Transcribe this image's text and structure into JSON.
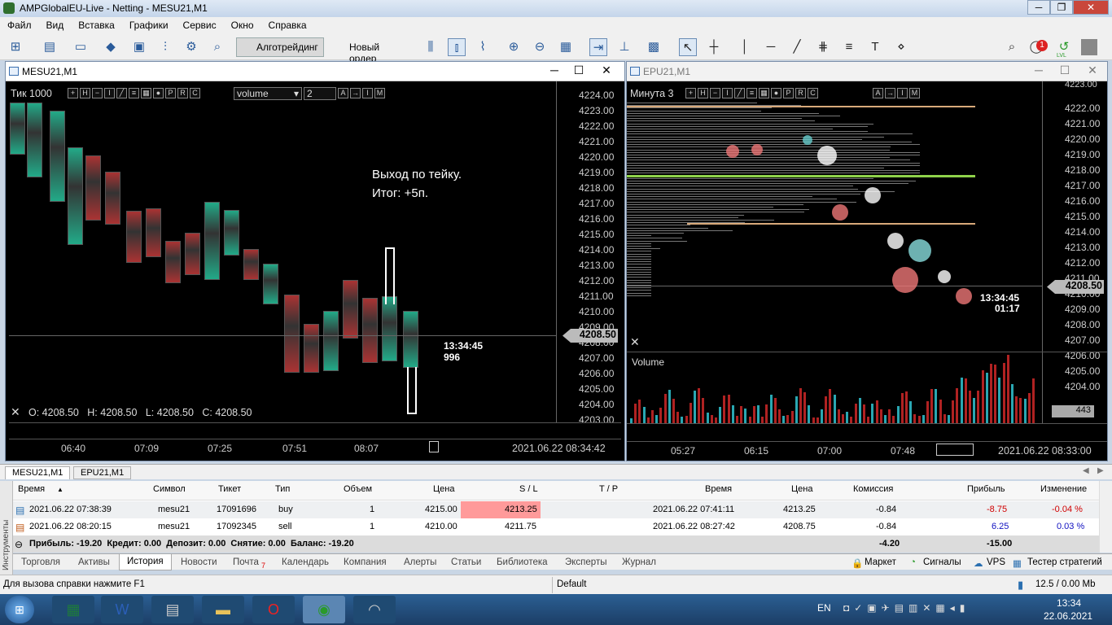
{
  "window": {
    "title": "AMPGlobalEU-Live - Netting - MESU21,M1"
  },
  "menu": [
    "Файл",
    "Вид",
    "Вставка",
    "Графики",
    "Сервис",
    "Окно",
    "Справка"
  ],
  "toolbar": {
    "algo": "Алготрейдинг",
    "new_order": "Новый ордер",
    "notif_count": "1",
    "lvl": "LVL"
  },
  "chart1": {
    "title": "MESU21,M1",
    "mode": "Тик  1000",
    "select": "volume",
    "num": "2",
    "prices": [
      "4224.00",
      "4223.00",
      "4222.00",
      "4221.00",
      "4220.00",
      "4219.00",
      "4218.00",
      "4217.00",
      "4216.00",
      "4215.00",
      "4214.00",
      "4213.00",
      "4212.00",
      "4211.00",
      "4210.00",
      "4209.00",
      "4208.00",
      "4207.00",
      "4206.00",
      "4205.00",
      "4204.00",
      "4203.00"
    ],
    "current": "4208.50",
    "timer": "13:34:45",
    "timer2": "996",
    "annotation1": "Выход по тейку.",
    "annotation2": "Итог: +5п.",
    "ohlc": "O: 4208.50   H: 4208.50   L: 4208.50   C: 4208.50",
    "times": [
      "06:40",
      "07:09",
      "07:25",
      "07:51",
      "08:07"
    ],
    "date": "2021.06.22 08:34:42"
  },
  "chart2": {
    "title": "EPU21,M1",
    "mode": "Минута  3",
    "prices": [
      "4222.00",
      "4221.00",
      "4220.00",
      "4219.00",
      "4218.00",
      "4217.00",
      "4216.00",
      "4215.00",
      "4214.00",
      "4213.00",
      "4212.00",
      "4211.00",
      "4210.00",
      "4209.00",
      "4208.00",
      "4207.00",
      "4206.00",
      "4205.00",
      "4204.00"
    ],
    "top_price": "4223.00",
    "current": "4208.50",
    "timer": "13:34:45",
    "timer2": "01:17",
    "volume_label": "Volume",
    "volume_value": "443",
    "times": [
      "05:27",
      "06:15",
      "07:00",
      "07:48"
    ],
    "date": "2021.06.22 08:33:00"
  },
  "chart_tabs": [
    "MESU21,M1",
    "EPU21,M1"
  ],
  "table": {
    "headers": [
      "Время",
      "Символ",
      "Тикет",
      "Тип",
      "Объем",
      "Цена",
      "S / L",
      "T / P",
      "Время",
      "Цена",
      "Комиссия",
      "Прибыль",
      "Изменение"
    ],
    "rows": [
      [
        "2021.06.22 07:38:39",
        "mesu21",
        "17091696",
        "buy",
        "1",
        "4215.00",
        "4213.25",
        "",
        "2021.06.22 07:41:11",
        "4213.25",
        "-0.84",
        "-8.75",
        "-0.04 %"
      ],
      [
        "2021.06.22 08:20:15",
        "mesu21",
        "17092345",
        "sell",
        "1",
        "4210.00",
        "4211.75",
        "",
        "2021.06.22 08:27:42",
        "4208.75",
        "-0.84",
        "6.25",
        "0.03 %"
      ]
    ],
    "summary": "Прибыль: -19.20  Кредит: 0.00  Депозит: 0.00  Снятие: 0.00  Баланс: -19.20",
    "sum_commission": "-4.20",
    "sum_profit": "-15.00",
    "side_label": "Инструменты"
  },
  "bottom_tabs": [
    "Торговля",
    "Активы",
    "История",
    "Новости",
    "Почта",
    "Календарь",
    "Компания",
    "Алерты",
    "Статьи",
    "Библиотека",
    "Эксперты",
    "Журнал"
  ],
  "mail_count": "7",
  "right_links": [
    "Маркет",
    "Сигналы",
    "VPS",
    "Тестер стратегий"
  ],
  "status": {
    "help": "Для вызова справки нажмите F1",
    "profile": "Default",
    "traffic": "12.5 / 0.00 Mb"
  },
  "taskbar": {
    "lang": "EN",
    "time": "13:34",
    "date": "22.06.2021"
  },
  "colors": {
    "loss": "#ff9a9a",
    "profit_neg": "#d00000",
    "profit_pos": "#1010c0",
    "chart_bg": "#000000"
  }
}
